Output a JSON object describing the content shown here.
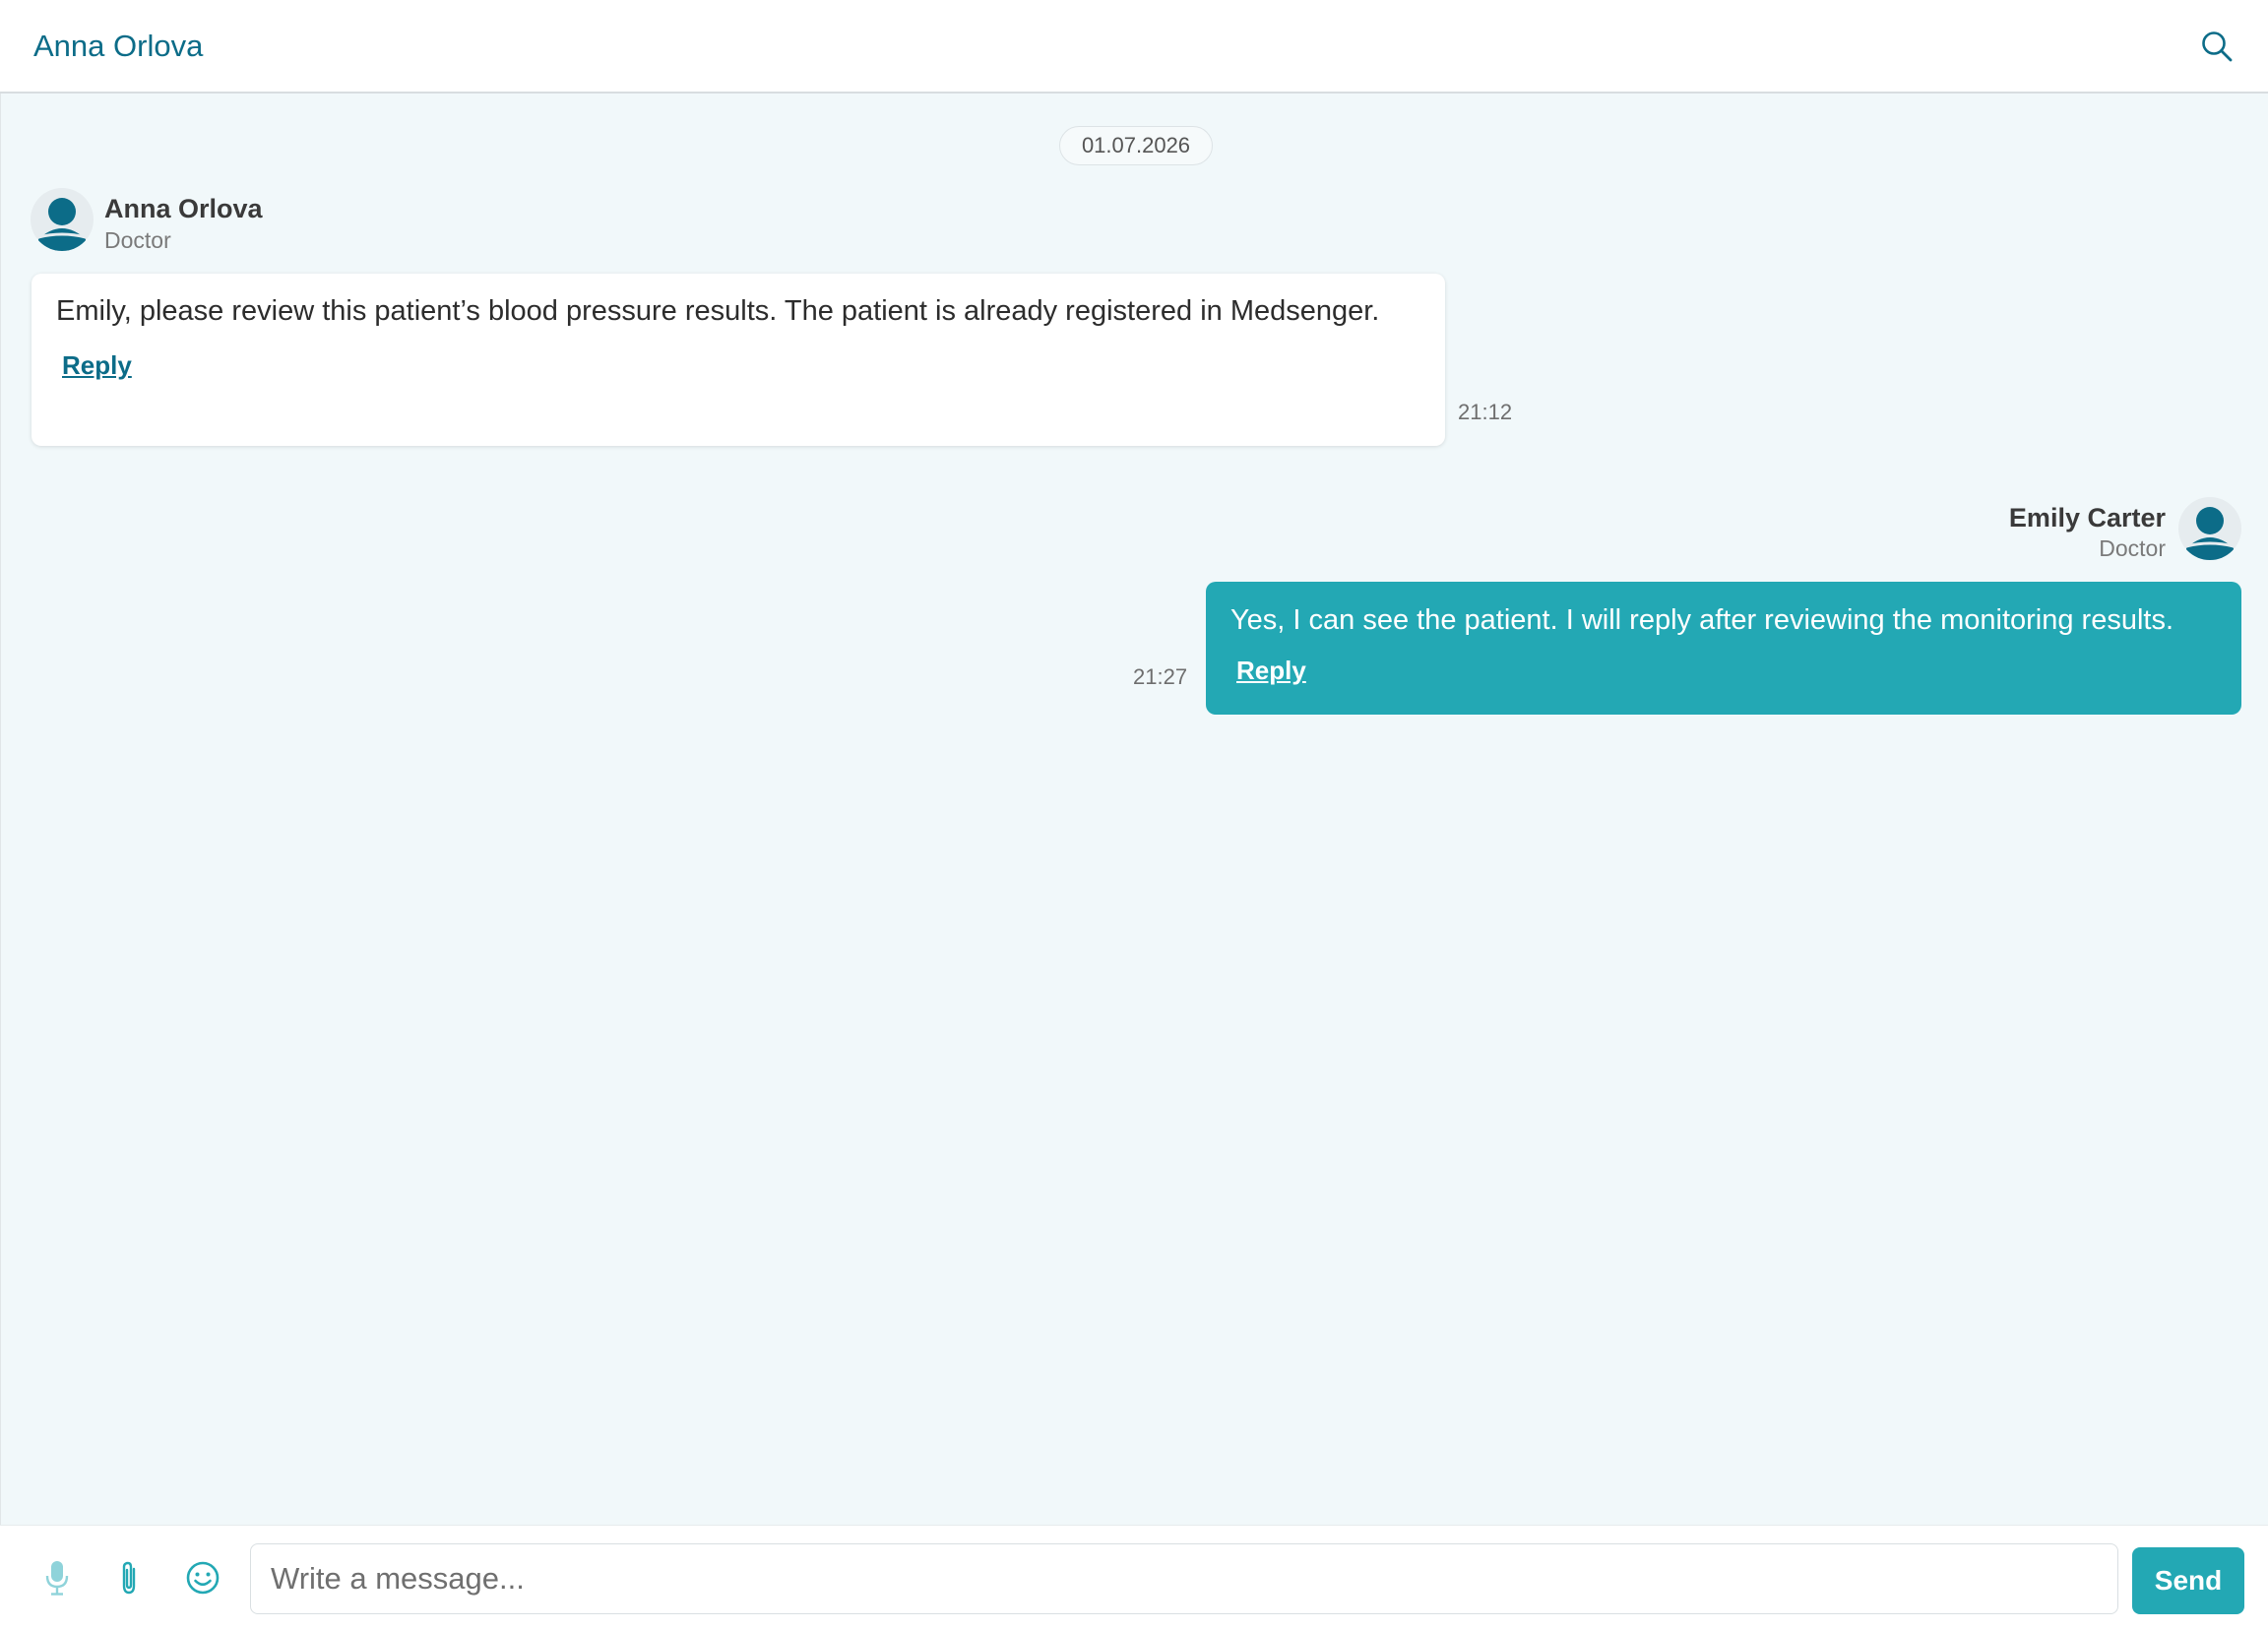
{
  "header": {
    "title": "Anna Orlova",
    "search_icon": "search-icon"
  },
  "chat": {
    "date_divider": "01.07.2026",
    "messages": [
      {
        "sender": "Anna Orlova",
        "role": "Doctor",
        "text": "Emily, please review this patient’s blood pressure results. The patient is already registered in Medsenger.",
        "time": "21:12",
        "reply_label": "Reply",
        "direction": "incoming"
      },
      {
        "sender": "Emily Carter",
        "role": "Doctor",
        "text": "Yes, I can see the patient. I will reply after reviewing the monitoring results.",
        "time": "21:27",
        "reply_label": "Reply",
        "direction": "outgoing"
      }
    ]
  },
  "composer": {
    "placeholder": "Write a message...",
    "value": "",
    "send_label": "Send",
    "icons": [
      "microphone-icon",
      "paperclip-icon",
      "emoji-icon"
    ]
  },
  "colors": {
    "accent": "#23a8b4",
    "header_text": "#0c6c88",
    "avatar": "#0c6c88",
    "chat_background": "#f1f8fa"
  }
}
